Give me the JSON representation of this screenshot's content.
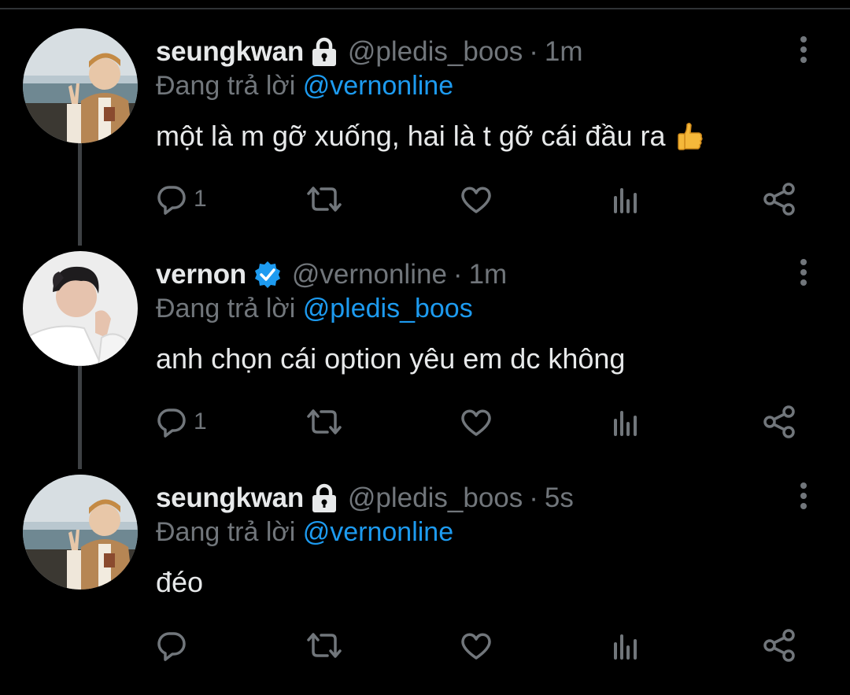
{
  "colors": {
    "background": "#000000",
    "text": "#E7E9EA",
    "muted": "#71767B",
    "link": "#1D9BF0",
    "verified": "#1D9BF0"
  },
  "tweets": [
    {
      "name": "seungkwan",
      "badge": "lock-icon",
      "handle": "@pledis_boos",
      "dot": "·",
      "time": "1m",
      "reply_prefix": "Đang trả lời",
      "reply_to": "@vernonline",
      "text": "một là m gỡ xuống, hai là t gỡ cái đầu ra",
      "emoji": "thumbs-up-icon",
      "reply_count": "1"
    },
    {
      "name": "vernon",
      "badge": "verified-icon",
      "handle": "@vernonline",
      "dot": "·",
      "time": "1m",
      "reply_prefix": "Đang trả lời",
      "reply_to": "@pledis_boos",
      "text": "anh chọn cái option yêu em dc không",
      "reply_count": "1"
    },
    {
      "name": "seungkwan",
      "badge": "lock-icon",
      "handle": "@pledis_boos",
      "dot": "·",
      "time": "5s",
      "reply_prefix": "Đang trả lời",
      "reply_to": "@vernonline",
      "text": "đéo",
      "reply_count": ""
    }
  ]
}
